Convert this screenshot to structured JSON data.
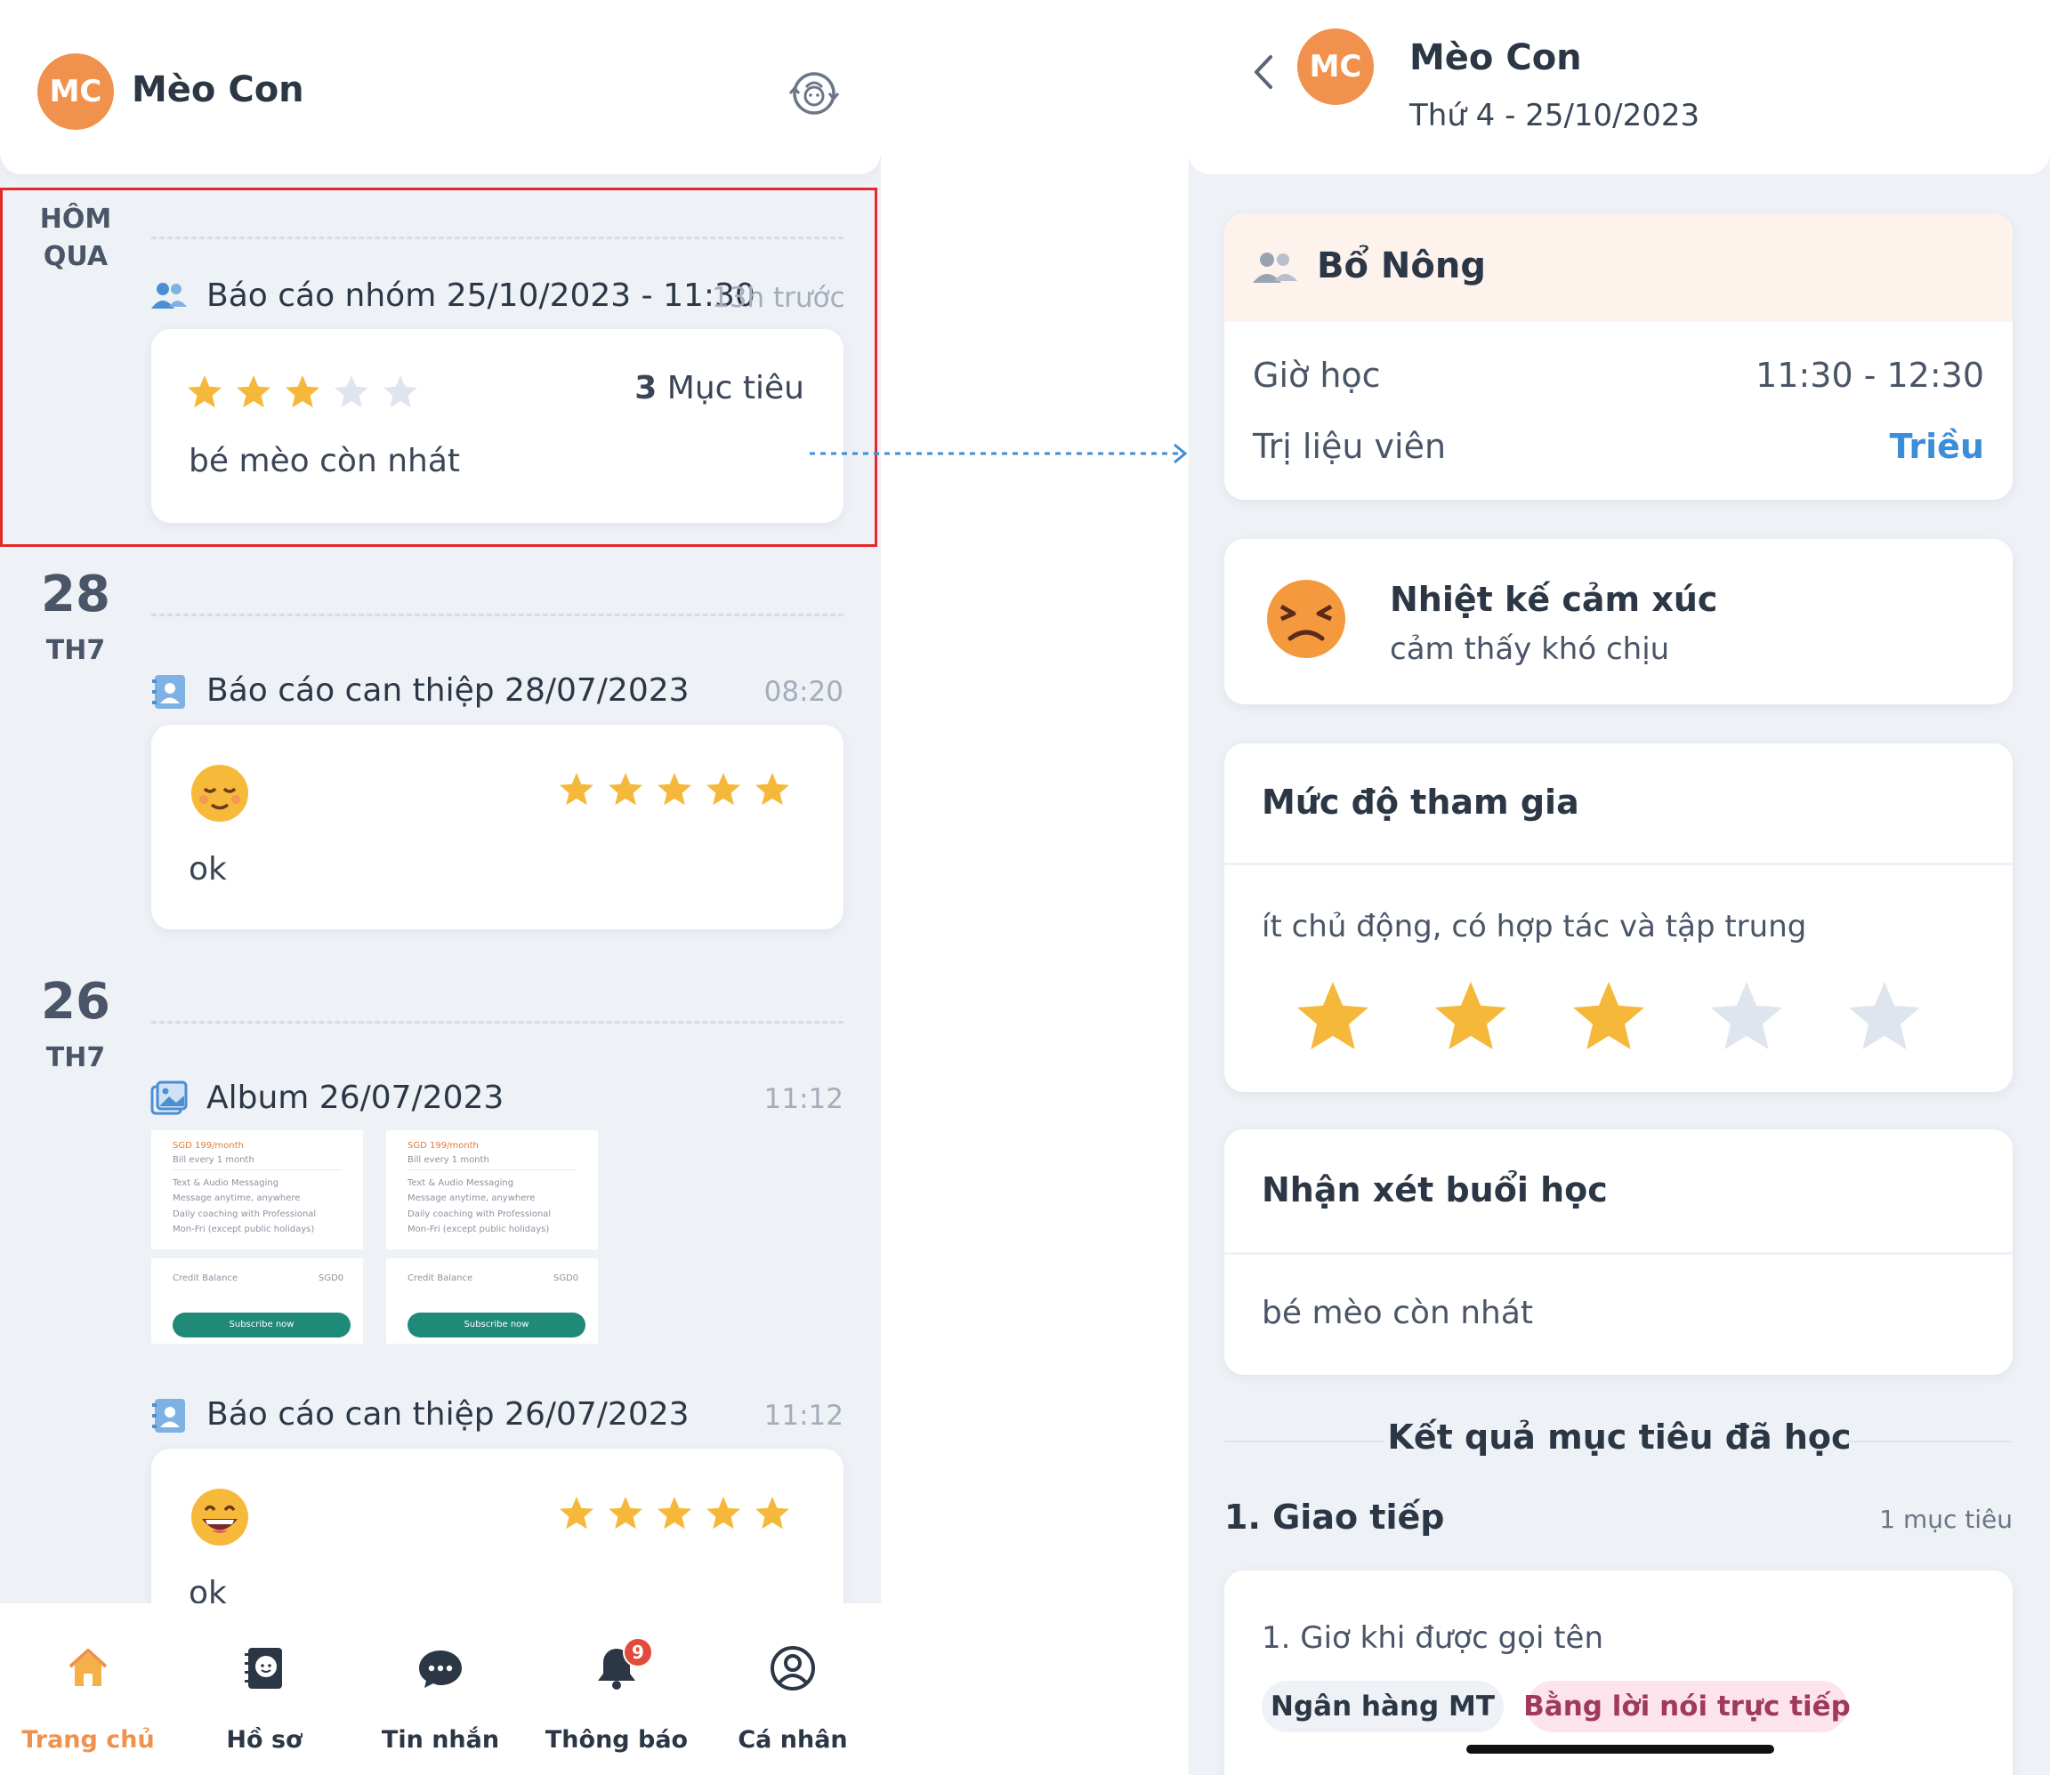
{
  "left": {
    "header": {
      "avatar_initials": "MC",
      "name": "Mèo Con",
      "switch_icon": "child-switch-icon"
    },
    "groups": [
      {
        "day_line1": "HÔM",
        "day_line2": "QUA",
        "entries": [
          {
            "icon": "group-icon",
            "title": "Báo cáo nhóm 25/10/2023 - 11:30",
            "time": "13h trước",
            "rating": 3,
            "rating_max": 5,
            "goal_count": "3",
            "goal_label": "Mục tiêu",
            "comment": "bé mèo còn nhát"
          }
        ]
      },
      {
        "day_number": "28",
        "weekday": "TH7",
        "entries": [
          {
            "icon": "report-icon",
            "title": "Báo cáo can thiệp 28/07/2023",
            "time": "08:20",
            "emoji": "relieved-face-emoji",
            "rating": 5,
            "rating_max": 5,
            "comment": "ok"
          }
        ]
      },
      {
        "day_number": "26",
        "weekday": "TH7",
        "entries": [
          {
            "icon": "album-icon",
            "title": "Album 26/07/2023",
            "time": "11:12",
            "thumbnails": [
              {
                "price": "SGD 199/month",
                "billing": "Bill every 1 month",
                "features": [
                  "Text & Audio Messaging",
                  "Message anytime, anywhere",
                  "Daily coaching with Professional",
                  "Mon-Fri (except public holidays)"
                ],
                "credit_label": "Credit Balance",
                "credit_value": "SGD0",
                "button": "Subscribe now"
              },
              {
                "price": "SGD 199/month",
                "billing": "Bill every 1 month",
                "features": [
                  "Text & Audio Messaging",
                  "Message anytime, anywhere",
                  "Daily coaching with Professional",
                  "Mon-Fri (except public holidays)"
                ],
                "credit_label": "Credit Balance",
                "credit_value": "SGD0",
                "button": "Subscribe now"
              }
            ]
          },
          {
            "icon": "report-icon",
            "title": "Báo cáo can thiệp 26/07/2023",
            "time": "11:12",
            "emoji": "grinning-face-emoji",
            "rating": 5,
            "rating_max": 5,
            "comment": "ok"
          }
        ]
      }
    ],
    "nav": [
      {
        "label": "Trang chủ",
        "icon": "home-icon",
        "active": true
      },
      {
        "label": "Hồ sơ",
        "icon": "profile-book-icon"
      },
      {
        "label": "Tin nhắn",
        "icon": "chat-icon"
      },
      {
        "label": "Thông báo",
        "icon": "bell-icon",
        "badge": "9"
      },
      {
        "label": "Cá nhân",
        "icon": "user-circle-icon"
      }
    ],
    "colors": {
      "accent": "#f0924e",
      "highlight_border": "#e32929",
      "star": "#f5b83a",
      "star_off": "#dfe5ee"
    }
  },
  "right": {
    "header": {
      "avatar_initials": "MC",
      "name": "Mèo Con",
      "date": "Thứ 4 - 25/10/2023"
    },
    "group_card": {
      "icon": "group-icon",
      "name": "Bổ Nông",
      "time_label": "Giờ học",
      "time_value": "11:30 - 12:30",
      "therapist_label": "Trị liệu viên",
      "therapist_value": "Triều"
    },
    "emotion": {
      "emoji": "persevering-face-emoji",
      "title": "Nhiệt kế cảm xúc",
      "value": "cảm thấy khó chịu"
    },
    "participation": {
      "title": "Mức độ tham gia",
      "description": "ít chủ động, có hợp tác và tập trung",
      "rating": 3,
      "rating_max": 5
    },
    "remarks": {
      "title": "Nhận xét buổi học",
      "text": "bé mèo còn nhát"
    },
    "results": {
      "title": "Kết quả mục tiêu đã học",
      "category": "1. Giao tiếp",
      "category_count": "1 mục tiêu",
      "goal": "1. Giơ khi được gọi tên",
      "tags": [
        "Ngân hàng MT",
        "Bằng lời nói trực tiếp"
      ]
    },
    "colors": {
      "link": "#3c8ed8",
      "group_header_bg": "#fdf3ec"
    }
  }
}
